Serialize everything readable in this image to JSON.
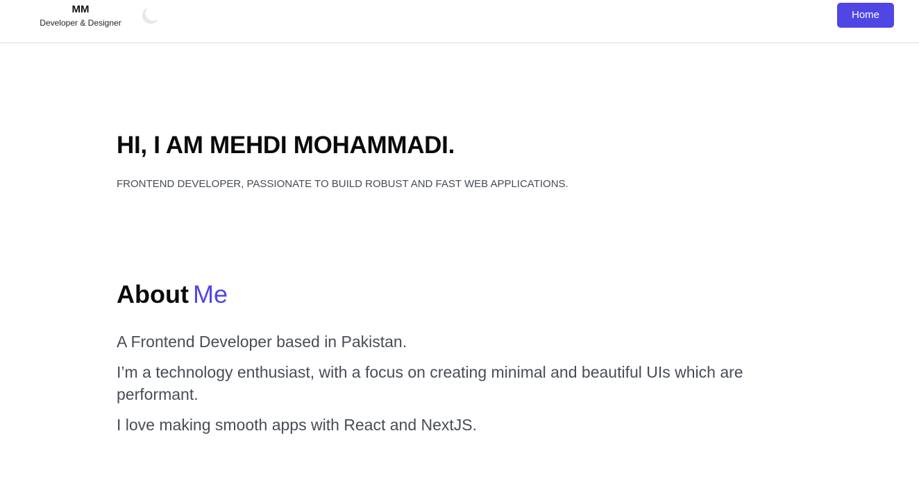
{
  "header": {
    "brand_title": "MM",
    "brand_subtitle": "Developer & Designer",
    "theme_toggle_icon": "moon-icon",
    "nav": {
      "home_label": "Home"
    }
  },
  "hero": {
    "title": "HI, I AM MEHDI MOHAMMADI.",
    "subtitle": "FRONTEND DEVELOPER, PASSIONATE TO BUILD ROBUST AND FAST WEB APPLICATIONS."
  },
  "about": {
    "heading_strong": "About",
    "heading_accent": "Me",
    "paragraphs": [
      "A Frontend Developer based in Pakistan.",
      "I’m a technology enthusiast, with a focus on creating minimal and beautiful UIs which are performant.",
      "I love making smooth apps with React and NextJS."
    ]
  },
  "colors": {
    "accent": "#4f46e5",
    "text_dark": "#0a0a0a",
    "text_muted": "#474d57",
    "moon": "#e5e7eb"
  }
}
